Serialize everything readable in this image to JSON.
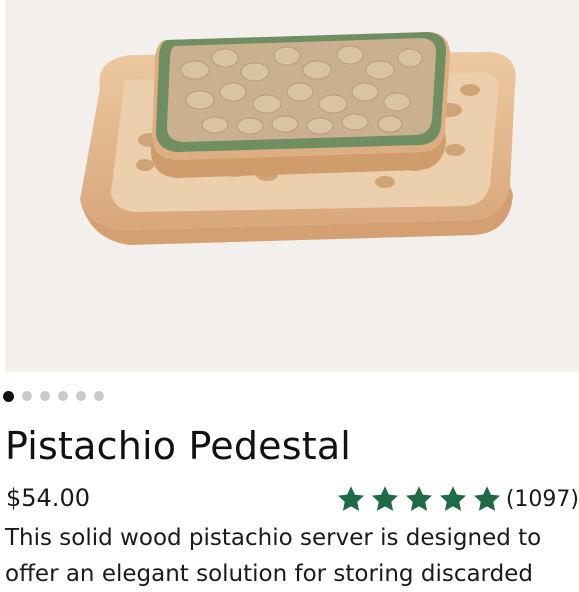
{
  "product": {
    "image_alt": "Wooden pistachio server with inner bowl of pistachios and outer tray of shells",
    "title": "Pistachio Pedestal",
    "price": "$54.00",
    "rating": {
      "stars": 5,
      "count_label": "(1097)"
    },
    "description": "This solid wood pistachio server is designed to offer an elegant solution for storing discarded"
  },
  "carousel": {
    "total": 6,
    "active_index": 0
  },
  "colors": {
    "star": "#1f6b47",
    "inner_bowl_rim": "#6f8f63",
    "wood": "#e2b98e",
    "background": "#f3efec"
  },
  "icons": {
    "star": "star-icon",
    "dot": "carousel-dot"
  }
}
